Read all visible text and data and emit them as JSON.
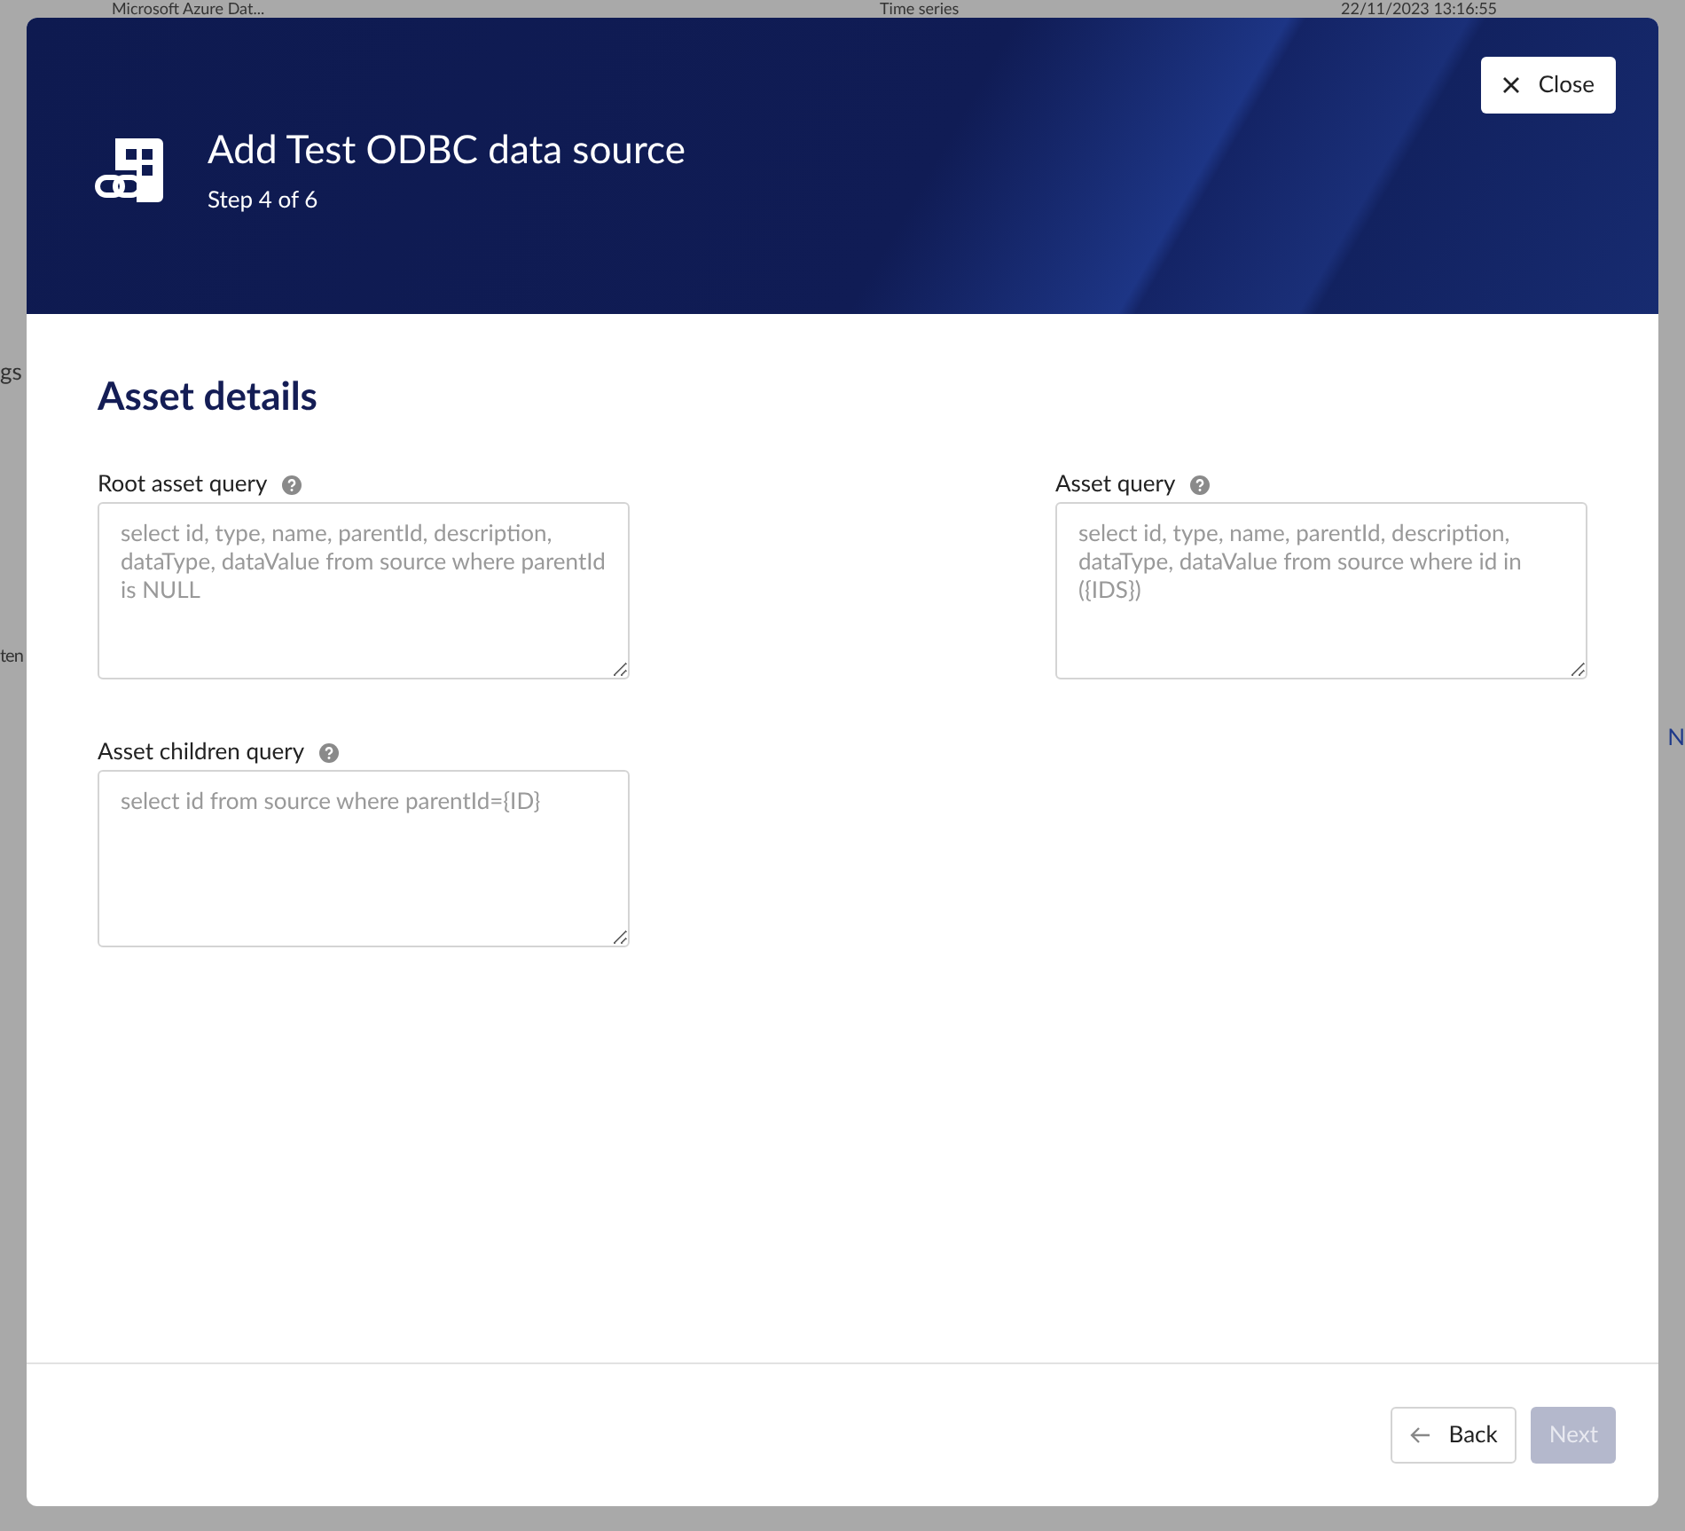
{
  "background": {
    "table_row": [
      "Microsoft Azure Dat...",
      "Time series",
      "22/11/2023 13:16:55"
    ],
    "fragments": [
      "gs",
      "ten",
      "N"
    ]
  },
  "dialog": {
    "title": "Add Test ODBC data source",
    "subtitle": "Step 4 of 6",
    "close_button": "Close",
    "section_title": "Asset details",
    "fields": [
      {
        "label": "Root asset query",
        "placeholder": "select id, type, name, parentId, description, dataType, dataValue from source where parentId is NULL"
      },
      {
        "label": "Asset query",
        "placeholder": "select id, type, name, parentId, description, dataType, dataValue from source where id in ({IDS})"
      },
      {
        "label": "Asset children query",
        "placeholder": "select id from source where parentId={ID}"
      }
    ],
    "buttons": [
      {
        "label": "Back",
        "kind": "back",
        "disabled": false
      },
      {
        "label": "Next",
        "kind": "next",
        "disabled": true
      }
    ]
  }
}
